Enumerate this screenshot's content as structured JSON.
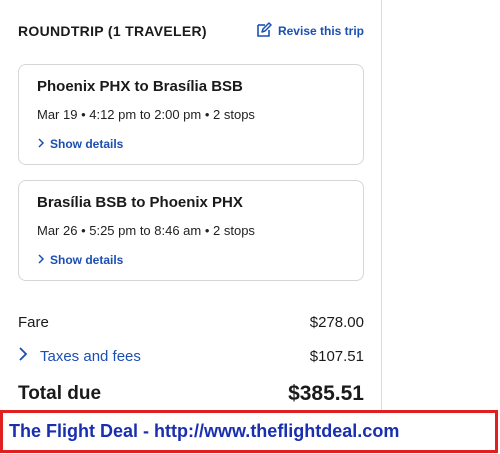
{
  "trip": {
    "heading": "ROUNDTRIP (1 TRAVELER)",
    "revise_label": "Revise this trip"
  },
  "legs": [
    {
      "title": "Phoenix PHX to Brasília BSB",
      "details": "Mar 19 • 4:12 pm to 2:00 pm • 2 stops",
      "show_details_label": "Show details"
    },
    {
      "title": "Brasília BSB to Phoenix PHX",
      "details": "Mar 26 • 5:25 pm to 8:46 am • 2 stops",
      "show_details_label": "Show details"
    }
  ],
  "pricing": {
    "fare_label": "Fare",
    "fare_amount": "$278.00",
    "taxes_label": "Taxes and fees",
    "taxes_amount": "$107.51",
    "total_label": "Total due",
    "total_amount": "$385.51"
  },
  "banner": {
    "text": "The Flight Deal - http://www.theflightdeal.com"
  },
  "colors": {
    "link_blue": "#1b4fb3",
    "banner_border": "#e02020",
    "banner_text": "#1a2fb0"
  }
}
